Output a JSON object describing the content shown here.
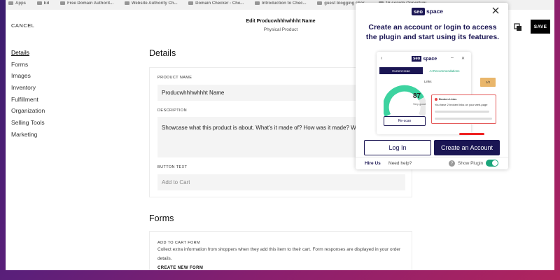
{
  "bookmarks": [
    "Apps",
    "Ed",
    "Free Domain Authorit...",
    "Website Authority Ch...",
    "Domain Checker - Che...",
    "Introduction to Chec...",
    "guest blogging shar...",
    "16 search Opportuni..."
  ],
  "topbar": {
    "cancel_label": "CANCEL",
    "product_title": "Edit Producwhhhwhhht Name",
    "product_subtitle": "Physical Product",
    "save_label": "SAVE"
  },
  "sidebar": {
    "items": [
      {
        "label": "Details"
      },
      {
        "label": "Forms"
      },
      {
        "label": "Images"
      },
      {
        "label": "Inventory"
      },
      {
        "label": "Fulfillment"
      },
      {
        "label": "Organization"
      },
      {
        "label": "Selling Tools"
      },
      {
        "label": "Marketing"
      }
    ]
  },
  "details": {
    "heading": "Details",
    "product_name_label": "PRODUCT NAME",
    "product_name_value": "Producwhhhwhhht Name",
    "description_label": "DESCRIPTION",
    "description_value": "Showcase what this product is about. What's it made of? How was it made? What are",
    "button_text_label": "BUTTON TEXT",
    "button_text_placeholder": "Add to Cart"
  },
  "forms": {
    "heading": "Forms",
    "add_to_cart_label": "ADD TO CART FORM",
    "description": "Collect extra information from shoppers when they add this item to their cart. Form responses are displayed in your order details.",
    "create_label": "CREATE NEW FORM"
  },
  "popup": {
    "logo_seo": "seo",
    "logo_space": "space",
    "headline": "Create an account or login to access the plugin and start using its features.",
    "illustration": {
      "current_scan": "Current scan",
      "ai_recommendations": "AI Recommendations",
      "links_label": "Links",
      "score": "87",
      "score_label": "Very good",
      "badge": "1/2",
      "rescan": "Re-scan",
      "broken_title": "Broken Links",
      "broken_msg": "You have 2 broken links on your web-page",
      "broken_url_1": "https://www.seoptimer.com/blog/...",
      "broken_url_2": "https://drive.com/storeforintegration..."
    },
    "login_label": "Log In",
    "create_label": "Create an Account",
    "hire_label": "Hire Us",
    "help_label": "Need help?",
    "show_plugin_label": "Show Plugin",
    "show_plugin_on": true
  },
  "colors": {
    "brand_navy": "#1a1553",
    "accent_green": "#1aa57a",
    "alert_red": "#e45a5a"
  }
}
